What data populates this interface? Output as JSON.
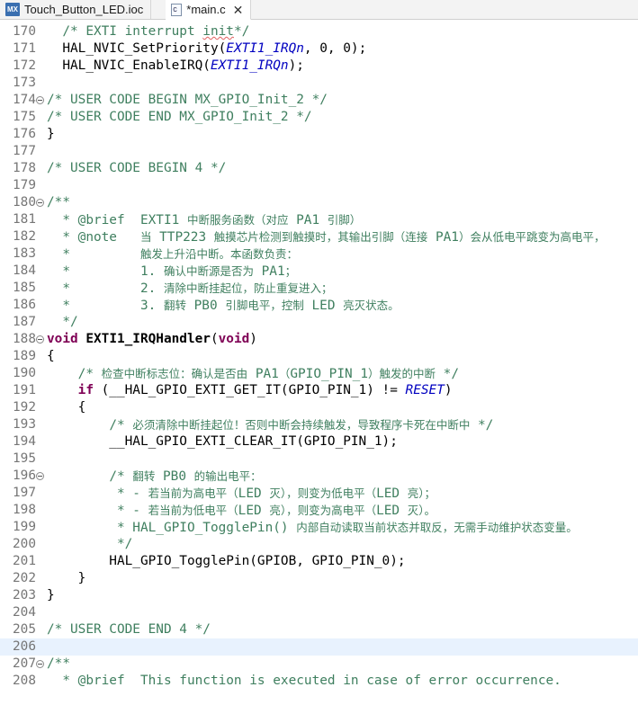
{
  "tabs": [
    {
      "icon": "mx-icon",
      "icon_text": "MX",
      "label": "Touch_Button_LED.ioc",
      "active": false
    },
    {
      "icon": "c-file-icon",
      "icon_text": "c",
      "label": "*main.c",
      "active": true,
      "close": "✕"
    }
  ],
  "lines": [
    {
      "n": "170",
      "segs": [
        {
          "t": "  "
        },
        {
          "t": "/* EXTI interrupt ",
          "c": "cm"
        },
        {
          "t": "init",
          "c": "cm sq"
        },
        {
          "t": "*/",
          "c": "cm"
        }
      ]
    },
    {
      "n": "171",
      "segs": [
        {
          "t": "  HAL_NVIC_SetPriority("
        },
        {
          "t": "EXTI1_IRQn",
          "c": "it"
        },
        {
          "t": ", 0, 0);"
        }
      ]
    },
    {
      "n": "172",
      "segs": [
        {
          "t": "  HAL_NVIC_EnableIRQ("
        },
        {
          "t": "EXTI1_IRQn",
          "c": "it"
        },
        {
          "t": ");"
        }
      ]
    },
    {
      "n": "173",
      "segs": []
    },
    {
      "n": "174",
      "fold": true,
      "segs": [
        {
          "t": "/* USER CODE BEGIN MX_GPIO_Init_2 */",
          "c": "cm"
        }
      ]
    },
    {
      "n": "175",
      "segs": [
        {
          "t": "/* USER CODE END MX_GPIO_Init_2 */",
          "c": "cm"
        }
      ]
    },
    {
      "n": "176",
      "segs": [
        {
          "t": "}"
        }
      ]
    },
    {
      "n": "177",
      "segs": []
    },
    {
      "n": "178",
      "segs": [
        {
          "t": "/* USER CODE BEGIN 4 */",
          "c": "cm"
        }
      ]
    },
    {
      "n": "179",
      "segs": []
    },
    {
      "n": "180",
      "fold": true,
      "segs": [
        {
          "t": "/**",
          "c": "cm"
        }
      ]
    },
    {
      "n": "181",
      "segs": [
        {
          "t": "  * @brief  EXTI1 ",
          "c": "cm"
        },
        {
          "t": "中断服务函数（对应",
          "c": "cm zh"
        },
        {
          "t": " PA1 ",
          "c": "cm"
        },
        {
          "t": "引脚）",
          "c": "cm zh"
        }
      ]
    },
    {
      "n": "182",
      "segs": [
        {
          "t": "  * @note   ",
          "c": "cm"
        },
        {
          "t": "当",
          "c": "cm zh"
        },
        {
          "t": " TTP223 ",
          "c": "cm"
        },
        {
          "t": "触摸芯片检测到触摸时，其输出引脚（连接",
          "c": "cm zh"
        },
        {
          "t": " PA1",
          "c": "cm"
        },
        {
          "t": "）会从低电平跳变为高电平，",
          "c": "cm zh"
        }
      ]
    },
    {
      "n": "183",
      "segs": [
        {
          "t": "  *         ",
          "c": "cm"
        },
        {
          "t": "触发上升沿中断。本函数负责：",
          "c": "cm zh"
        }
      ]
    },
    {
      "n": "184",
      "segs": [
        {
          "t": "  *         1. ",
          "c": "cm"
        },
        {
          "t": "确认中断源是否为",
          "c": "cm zh"
        },
        {
          "t": " PA1",
          "c": "cm"
        },
        {
          "t": "；",
          "c": "cm zh"
        }
      ]
    },
    {
      "n": "185",
      "segs": [
        {
          "t": "  *         2. ",
          "c": "cm"
        },
        {
          "t": "清除中断挂起位，防止重复进入；",
          "c": "cm zh"
        }
      ]
    },
    {
      "n": "186",
      "segs": [
        {
          "t": "  *         3. ",
          "c": "cm"
        },
        {
          "t": "翻转",
          "c": "cm zh"
        },
        {
          "t": " PB0 ",
          "c": "cm"
        },
        {
          "t": "引脚电平，控制",
          "c": "cm zh"
        },
        {
          "t": " LED ",
          "c": "cm"
        },
        {
          "t": "亮灭状态。",
          "c": "cm zh"
        }
      ]
    },
    {
      "n": "187",
      "segs": [
        {
          "t": "  */",
          "c": "cm"
        }
      ]
    },
    {
      "n": "188",
      "fold": true,
      "segs": [
        {
          "t": "void",
          "c": "kw"
        },
        {
          "t": " "
        },
        {
          "t": "EXTI1_IRQHandler",
          "c": "bf"
        },
        {
          "t": "("
        },
        {
          "t": "void",
          "c": "kw"
        },
        {
          "t": ")"
        }
      ]
    },
    {
      "n": "189",
      "segs": [
        {
          "t": "{"
        }
      ]
    },
    {
      "n": "190",
      "segs": [
        {
          "t": "    "
        },
        {
          "t": "/* ",
          "c": "cm"
        },
        {
          "t": "检查中断标志位：确认是否由",
          "c": "cm zh"
        },
        {
          "t": " PA1",
          "c": "cm"
        },
        {
          "t": "（",
          "c": "cm zh"
        },
        {
          "t": "GPIO_PIN_1",
          "c": "cm"
        },
        {
          "t": "）触发的中断",
          "c": "cm zh"
        },
        {
          "t": " */",
          "c": "cm"
        }
      ]
    },
    {
      "n": "191",
      "segs": [
        {
          "t": "    "
        },
        {
          "t": "if",
          "c": "kw"
        },
        {
          "t": " (__HAL_GPIO_EXTI_GET_IT(GPIO_PIN_1) != "
        },
        {
          "t": "RESET",
          "c": "it"
        },
        {
          "t": ")"
        }
      ]
    },
    {
      "n": "192",
      "segs": [
        {
          "t": "    {"
        }
      ]
    },
    {
      "n": "193",
      "segs": [
        {
          "t": "        "
        },
        {
          "t": "/* ",
          "c": "cm"
        },
        {
          "t": "必须清除中断挂起位！否则中断会持续触发，导致程序卡死在中断中",
          "c": "cm zh"
        },
        {
          "t": " */",
          "c": "cm"
        }
      ]
    },
    {
      "n": "194",
      "segs": [
        {
          "t": "        __HAL_GPIO_EXTI_CLEAR_IT(GPIO_PIN_1);"
        }
      ]
    },
    {
      "n": "195",
      "segs": []
    },
    {
      "n": "196",
      "fold": true,
      "segs": [
        {
          "t": "        "
        },
        {
          "t": "/* ",
          "c": "cm"
        },
        {
          "t": "翻转",
          "c": "cm zh"
        },
        {
          "t": " PB0 ",
          "c": "cm"
        },
        {
          "t": "的输出电平：",
          "c": "cm zh"
        }
      ]
    },
    {
      "n": "197",
      "segs": [
        {
          "t": "         * - ",
          "c": "cm"
        },
        {
          "t": "若当前为高电平（",
          "c": "cm zh"
        },
        {
          "t": "LED ",
          "c": "cm"
        },
        {
          "t": "灭），则变为低电平（",
          "c": "cm zh"
        },
        {
          "t": "LED ",
          "c": "cm"
        },
        {
          "t": "亮）；",
          "c": "cm zh"
        }
      ]
    },
    {
      "n": "198",
      "segs": [
        {
          "t": "         * - ",
          "c": "cm"
        },
        {
          "t": "若当前为低电平（",
          "c": "cm zh"
        },
        {
          "t": "LED ",
          "c": "cm"
        },
        {
          "t": "亮），则变为高电平（",
          "c": "cm zh"
        },
        {
          "t": "LED ",
          "c": "cm"
        },
        {
          "t": "灭）。",
          "c": "cm zh"
        }
      ]
    },
    {
      "n": "199",
      "segs": [
        {
          "t": "         * HAL_GPIO_TogglePin() ",
          "c": "cm"
        },
        {
          "t": "内部自动读取当前状态并取反，无需手动维护状态变量。",
          "c": "cm zh"
        }
      ]
    },
    {
      "n": "200",
      "segs": [
        {
          "t": "         */",
          "c": "cm"
        }
      ]
    },
    {
      "n": "201",
      "segs": [
        {
          "t": "        HAL_GPIO_TogglePin(GPIOB, GPIO_PIN_0);"
        }
      ]
    },
    {
      "n": "202",
      "segs": [
        {
          "t": "    }"
        }
      ]
    },
    {
      "n": "203",
      "segs": [
        {
          "t": "}"
        }
      ]
    },
    {
      "n": "204",
      "segs": []
    },
    {
      "n": "205",
      "segs": [
        {
          "t": "/* USER CODE END 4 */",
          "c": "cm"
        }
      ]
    },
    {
      "n": "206",
      "hl": true,
      "segs": []
    },
    {
      "n": "207",
      "fold": true,
      "segs": [
        {
          "t": "/**",
          "c": "cm"
        }
      ]
    },
    {
      "n": "208",
      "segs": [
        {
          "t": "  * @brief  This function is executed in case of error occurrence.",
          "c": "cm"
        }
      ]
    }
  ]
}
